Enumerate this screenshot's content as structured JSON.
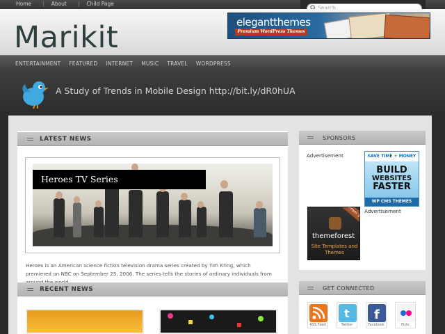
{
  "topnav": {
    "items": [
      "Home",
      "About",
      "Child Page"
    ],
    "separator": "|"
  },
  "search": {
    "placeholder": "Search"
  },
  "header": {
    "logo": "Marikit"
  },
  "banner": {
    "brand": "elegantthemes",
    "tagline": "Premium WordPress Themes"
  },
  "nav": {
    "items": [
      "ENTERTAINMENT",
      "FEATURED",
      "INTERNET",
      "MUSIC",
      "TRAVEL",
      "WORDPRESS"
    ]
  },
  "tweet": {
    "text": "A Study of Trends in Mobile Design http://bit.ly/dR0hUA"
  },
  "latest_news": {
    "title": "LATEST NEWS",
    "feature_title": "Heroes TV Series",
    "excerpt": "Heroes is an American science fiction television drama series created by Tim Kring, which premiered on NBC on September 25, 2006. The series tells the stories of ordinary individuals from around the world..."
  },
  "recent_news": {
    "title": "RECENT NEWS"
  },
  "sponsors": {
    "title": "SPONSORS",
    "ad_label": "Advertisement",
    "ad1": {
      "top": "SAVE TIME + MONEY",
      "line1": "BUILD",
      "line2": "WEBSITES",
      "line3": "FASTER",
      "bottom": "WP CMS THEMES"
    },
    "ad2": {
      "badge": "From $5",
      "name": "themeforest",
      "desc": "Site Templates and Themes"
    }
  },
  "get_connected": {
    "title": "GET CONNECTED",
    "items": [
      {
        "label": "RSS Feed",
        "color": "#e8761f"
      },
      {
        "label": "Twitter",
        "color": "#56b9e4"
      },
      {
        "label": "Facebook",
        "color": "#3b5998"
      },
      {
        "label": "flickr",
        "color": "#f5f5f5"
      }
    ]
  },
  "colors": {
    "accent": "#3a8fc6",
    "nav_bg": "#4a4a4a",
    "content_bg": "#e3e3e3"
  }
}
